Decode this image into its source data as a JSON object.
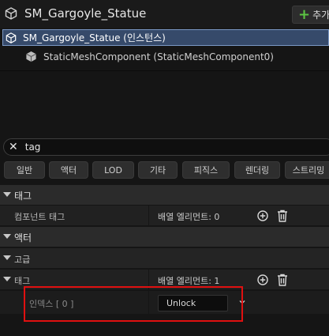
{
  "header": {
    "title": "SM_Gargoyle_Statue",
    "add_label": "추가"
  },
  "tree": {
    "selected_label": "SM_Gargoyle_Statue (인스턴스)",
    "child_label": "StaticMeshComponent (StaticMeshComponent0)"
  },
  "search": {
    "value": "tag"
  },
  "filters": [
    "일반",
    "액터",
    "LOD",
    "기타",
    "피직스",
    "렌더링",
    "스트리밍"
  ],
  "details": {
    "cat_tags": "태그",
    "component_tags_label": "컴포넌트 태그",
    "component_tags_value": "배열 엘리먼트: 0",
    "cat_actor": "액터",
    "cat_advanced": "고급",
    "tags_label": "태그",
    "tags_value": "배열 엘리먼트: 1",
    "index_label": "인덱스 [ 0 ]",
    "index_value": "Unlock"
  },
  "colors": {
    "accent_plus": "#5cc542",
    "selection_bg": "#364a6a",
    "highlight_box": "#e01010"
  }
}
